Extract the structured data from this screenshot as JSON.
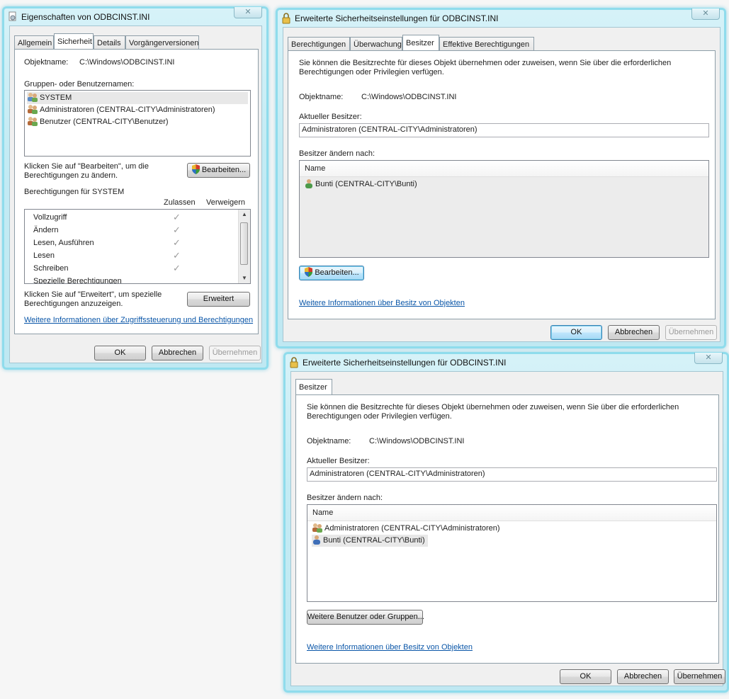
{
  "win1": {
    "title": "Eigenschaften von ODBCINST.INI",
    "close": "✕",
    "tabs": [
      "Allgemein",
      "Sicherheit",
      "Details",
      "Vorgängerversionen"
    ],
    "object_label": "Objektname:",
    "object_value": "C:\\Windows\\ODBCINST.INI",
    "groups_label": "Gruppen- oder Benutzernamen:",
    "groups": [
      {
        "name": "SYSTEM",
        "icon": "users-icon"
      },
      {
        "name": "Administratoren (CENTRAL-CITY\\Administratoren)",
        "icon": "users-icon"
      },
      {
        "name": "Benutzer (CENTRAL-CITY\\Benutzer)",
        "icon": "users-icon"
      }
    ],
    "edit_hint_1": "Klicken Sie auf \"Bearbeiten\", um die",
    "edit_hint_2": "Berechtigungen zu ändern.",
    "edit_button": "Bearbeiten...",
    "perm_label": "Berechtigungen für SYSTEM",
    "col_allow": "Zulassen",
    "col_deny": "Verweigern",
    "permissions": [
      {
        "name": "Vollzugriff",
        "allow": true
      },
      {
        "name": "Ändern",
        "allow": true
      },
      {
        "name": "Lesen, Ausführen",
        "allow": true
      },
      {
        "name": "Lesen",
        "allow": true
      },
      {
        "name": "Schreiben",
        "allow": true
      },
      {
        "name": "Spezielle Berechtigungen",
        "allow": false
      }
    ],
    "adv_hint_1": "Klicken Sie auf \"Erweitert\", um spezielle",
    "adv_hint_2": "Berechtigungen anzuzeigen.",
    "adv_button": "Erweitert",
    "link": "Weitere Informationen über Zugriffssteuerung und Berechtigungen",
    "ok": "OK",
    "cancel": "Abbrechen",
    "apply": "Übernehmen"
  },
  "win2": {
    "title": "Erweiterte Sicherheitseinstellungen für ODBCINST.INI",
    "close": "✕",
    "tabs": [
      "Berechtigungen",
      "Überwachung",
      "Besitzer",
      "Effektive Berechtigungen"
    ],
    "desc_1": "Sie können die Besitzrechte für dieses Objekt übernehmen oder zuweisen, wenn Sie über die erforderlichen",
    "desc_2": "Berechtigungen oder Privilegien verfügen.",
    "object_label": "Objektname:",
    "object_value": "C:\\Windows\\ODBCINST.INI",
    "owner_label": "Aktueller Besitzer:",
    "owner_value": "Administratoren (CENTRAL-CITY\\Administratoren)",
    "change_label": "Besitzer ändern nach:",
    "col_name": "Name",
    "candidates": [
      {
        "name": "Bunti (CENTRAL-CITY\\Bunti)",
        "icon": "user-icon"
      }
    ],
    "edit_button": "Bearbeiten...",
    "link": "Weitere Informationen über Besitz von Objekten",
    "ok": "OK",
    "cancel": "Abbrechen",
    "apply": "Übernehmen"
  },
  "win3": {
    "title": "Erweiterte Sicherheitseinstellungen für ODBCINST.INI",
    "close": "✕",
    "tabs": [
      "Besitzer"
    ],
    "desc_1": "Sie können die Besitzrechte für dieses Objekt übernehmen oder zuweisen, wenn Sie über die erforderlichen",
    "desc_2": "Berechtigungen oder Privilegien verfügen.",
    "object_label": "Objektname:",
    "object_value": "C:\\Windows\\ODBCINST.INI",
    "owner_label": "Aktueller Besitzer:",
    "owner_value": "Administratoren (CENTRAL-CITY\\Administratoren)",
    "change_label": "Besitzer ändern nach:",
    "col_name": "Name",
    "candidates": [
      {
        "name": "Administratoren (CENTRAL-CITY\\Administratoren)",
        "icon": "users-icon"
      },
      {
        "name": "Bunti (CENTRAL-CITY\\Bunti)",
        "icon": "user-icon"
      }
    ],
    "more_button": "Weitere Benutzer oder Gruppen...",
    "link": "Weitere Informationen über Besitz von Objekten",
    "ok": "OK",
    "cancel": "Abbrechen",
    "apply": "Übernehmen"
  }
}
